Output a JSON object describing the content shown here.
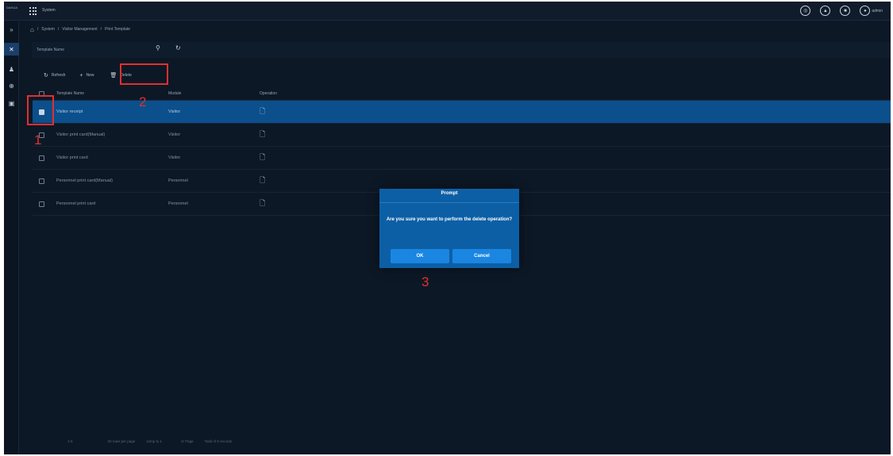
{
  "app": {
    "logo_text": "DAHUA",
    "title": "System"
  },
  "topbar": {
    "user_name": "admin"
  },
  "breadcrumb": [
    "System",
    "/",
    "Visitor Management",
    "/",
    "Print Template"
  ],
  "search": {
    "placeholder": "Template Name"
  },
  "toolbar": {
    "refresh_label": "Refresh",
    "new_label": "New",
    "delete_label": "Delete"
  },
  "table": {
    "columns": [
      "Template Name",
      "Module",
      "Operation"
    ],
    "rows": [
      {
        "name": "Visitor receipt",
        "module": "Visitor",
        "selected": true
      },
      {
        "name": "Visitor print card(Manual)",
        "module": "Visitor",
        "selected": false
      },
      {
        "name": "Visitor print card",
        "module": "Visitor",
        "selected": false
      },
      {
        "name": "Personnel print card(Manual)",
        "module": "Personnel",
        "selected": false
      },
      {
        "name": "Personnel print card",
        "module": "Personnel",
        "selected": false
      }
    ]
  },
  "footer": {
    "range": "1-5",
    "per_page": "20 rows per page",
    "jump": "Jump to 1",
    "pages": "/1 Page",
    "total": "Total of 5 records"
  },
  "dialog": {
    "title": "Prompt",
    "message": "Are you sure you want to perform the delete operation?",
    "ok_label": "OK",
    "cancel_label": "Cancel"
  },
  "annotations": {
    "step1": "1",
    "step2": "2",
    "step3": "3"
  },
  "colors": {
    "accent": "#0d5fa5",
    "selected_row": "#0b4f8c",
    "annotation": "#e0302f",
    "background": "#0d1826"
  }
}
